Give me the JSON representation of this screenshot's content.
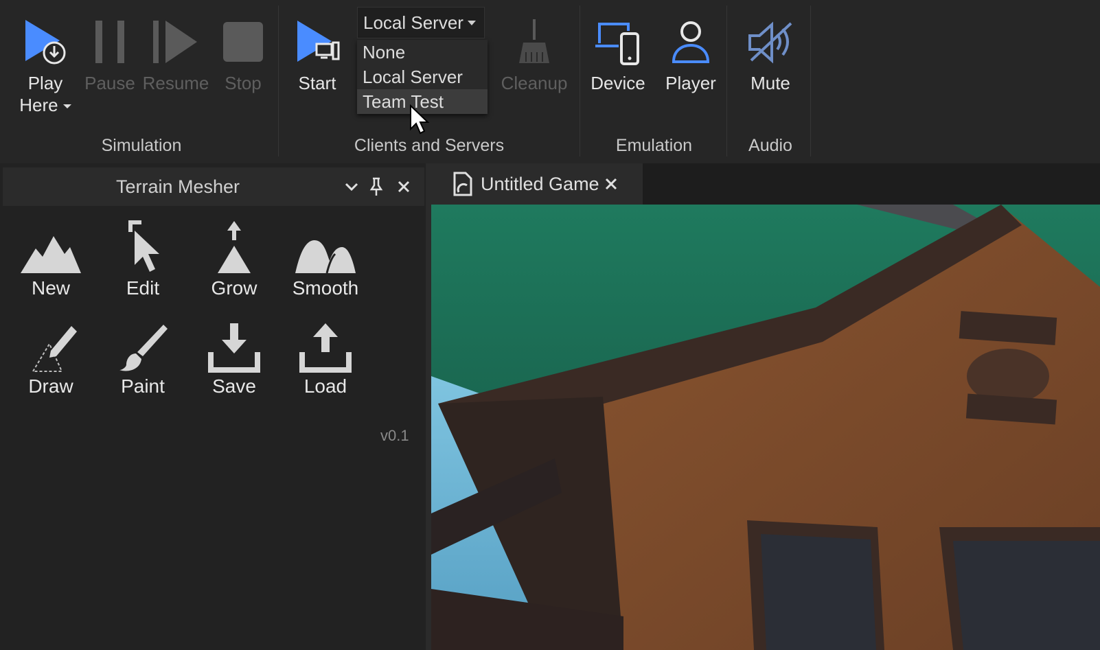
{
  "ribbon": {
    "simulation": {
      "label": "Simulation",
      "play_here_line1": "Play",
      "play_here_line2": "Here",
      "pause": "Pause",
      "resume": "Resume",
      "stop": "Stop"
    },
    "clients_servers": {
      "label": "Clients and Servers",
      "start": "Start",
      "selected_server": "Local Server",
      "server_options": [
        "None",
        "Local Server",
        "Team Test"
      ],
      "cleanup": "Cleanup"
    },
    "emulation": {
      "label": "Emulation",
      "device": "Device",
      "player": "Player"
    },
    "audio": {
      "label": "Audio",
      "mute": "Mute"
    }
  },
  "terrain_mesher": {
    "title": "Terrain Mesher",
    "tools": [
      "New",
      "Edit",
      "Grow",
      "Smooth",
      "Draw",
      "Paint",
      "Save",
      "Load"
    ],
    "version": "v0.1"
  },
  "viewport": {
    "tab_title": "Untitled Game"
  },
  "colors": {
    "accent": "#4a8cff",
    "panel": "#222222",
    "ribbon": "#262626",
    "sky": "#1f6f58"
  }
}
